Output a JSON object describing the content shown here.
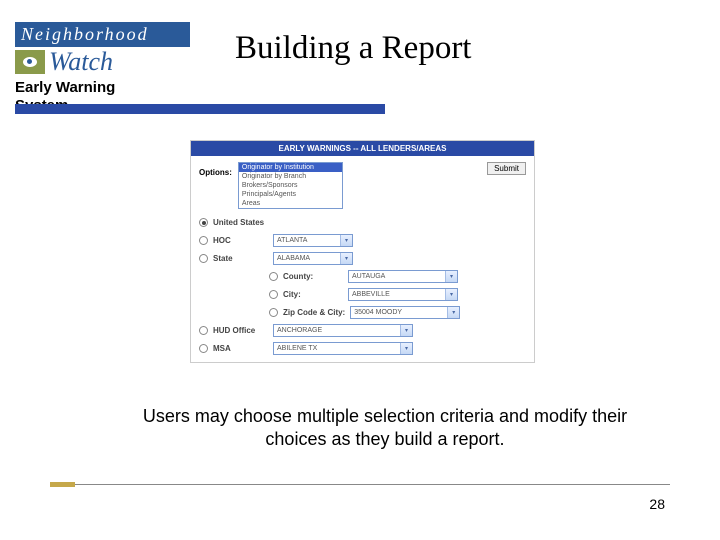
{
  "logo": {
    "top": "Neighborhood",
    "bottom": "Watch"
  },
  "subtitle": "Early Warning\nSystem",
  "title": "Building a Report",
  "form": {
    "header": "EARLY WARNINGS -- ALL LENDERS/AREAS",
    "options_label": "Options:",
    "listbox": [
      "Originator by Institution",
      "Originator by Branch",
      "Brokers/Sponsors",
      "Principals/Agents",
      "Areas"
    ],
    "submit": "Submit",
    "rows": {
      "us": "United States",
      "hoc": "HOC",
      "hoc_val": "ATLANTA",
      "state": "State",
      "state_val": "ALABAMA",
      "county": "County:",
      "county_val": "AUTAUGA",
      "city": "City:",
      "city_val": "ABBEVILLE",
      "zip": "Zip Code & City:",
      "zip_val": "35004 MOODY",
      "hud": "HUD Office",
      "hud_val": "ANCHORAGE",
      "msa": "MSA",
      "msa_val": "ABILENE TX"
    }
  },
  "caption": "Users may choose multiple selection criteria and modify their choices as they build a report.",
  "page": "28"
}
